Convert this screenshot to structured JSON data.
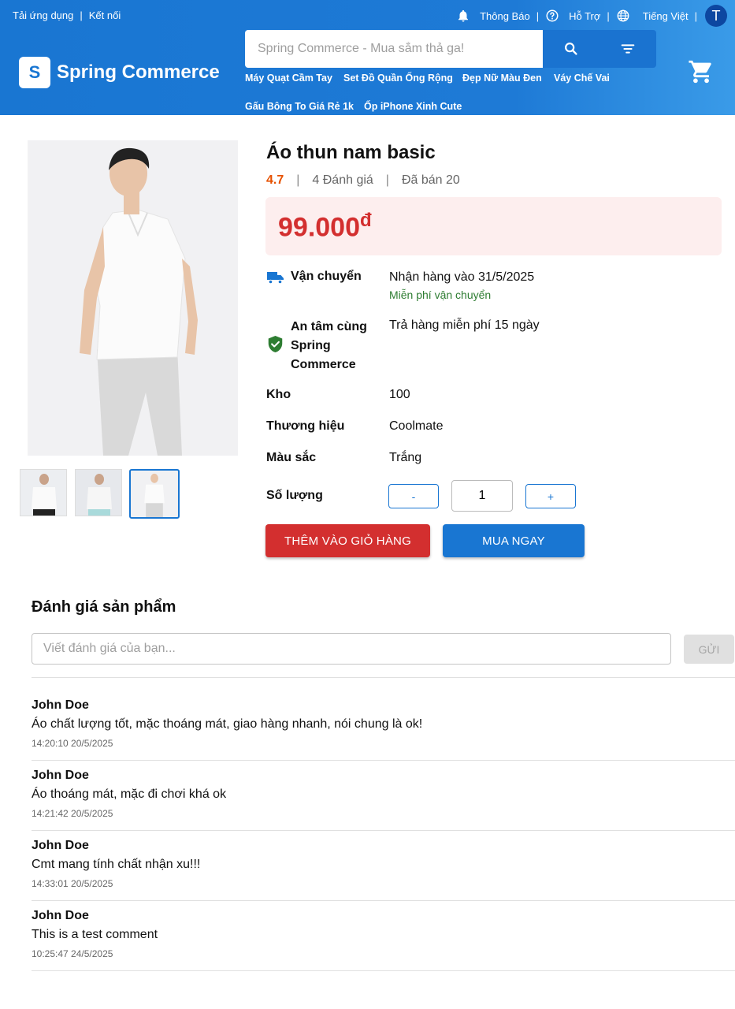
{
  "topbar": {
    "download_app": "Tải ứng dụng",
    "separator": "|",
    "connect": "Kết nối",
    "notifications": "Thông Báo",
    "support": "Hỗ Trợ",
    "language": "Tiếng Việt",
    "avatar_letter": "T"
  },
  "header": {
    "logo_letter": "S",
    "brand": "Spring Commerce",
    "search_placeholder": "Spring Commerce - Mua sắm thả ga!",
    "keywords": [
      "Máy Quạt Cầm Tay",
      "Set Đồ Quần Ống Rộng",
      "Đẹp Nữ Màu Đen",
      "Váy Chế Vai",
      "Gấu Bông To Giá Rẻ 1k",
      "Ốp iPhone Xinh Cute"
    ]
  },
  "product": {
    "title": "Áo thun nam basic",
    "rating": "4.7",
    "reviews_count": "4 Đánh giá",
    "sold": "Đã bán 20",
    "divider": "|",
    "price": "99.000",
    "currency": "đ",
    "shipping_label": "Vận chuyển",
    "shipping_value": "Nhận hàng vào 31/5/2025",
    "free_shipping": "Miễn phí vận chuyển",
    "guarantee_label_lines": [
      "An tâm cùng",
      "Spring",
      "Commerce"
    ],
    "guarantee_value": "Trả hàng miễn phí 15 ngày",
    "stock_label": "Kho",
    "stock_value": "100",
    "brand_label": "Thương hiệu",
    "brand_value": "Coolmate",
    "color_label": "Màu sắc",
    "color_value": "Trắng",
    "qty_label": "Số lượng",
    "qty_minus": "-",
    "qty_value": "1",
    "qty_plus": "+",
    "add_to_cart": "THÊM VÀO GIỎ HÀNG",
    "buy_now": "MUA NGAY"
  },
  "reviews": {
    "title": "Đánh giá sản phẩm",
    "input_placeholder": "Viết đánh giá của bạn...",
    "send": "GỬI",
    "items": [
      {
        "name": "John Doe",
        "text": "Áo chất lượng tốt, mặc thoáng mát, giao hàng nhanh, nói chung là ok!",
        "time": "14:20:10 20/5/2025"
      },
      {
        "name": "John Doe",
        "text": "Áo thoáng mát, mặc đi chơi khá ok",
        "time": "14:21:42 20/5/2025"
      },
      {
        "name": "John Doe",
        "text": "Cmt mang tính chất nhận xu!!!",
        "time": "14:33:01 20/5/2025"
      },
      {
        "name": "John Doe",
        "text": "This is a test comment",
        "time": "10:25:47 24/5/2025"
      }
    ]
  },
  "colors": {
    "primary": "#1976d2",
    "danger": "#d32f2f",
    "rating": "#e65100",
    "success": "#2e7d32",
    "price_bg": "#fdeeee"
  },
  "icons": [
    "bell-icon",
    "help-circle-icon",
    "globe-icon",
    "search-icon",
    "filter-icon",
    "cart-icon",
    "truck-icon",
    "shield-check-icon"
  ]
}
